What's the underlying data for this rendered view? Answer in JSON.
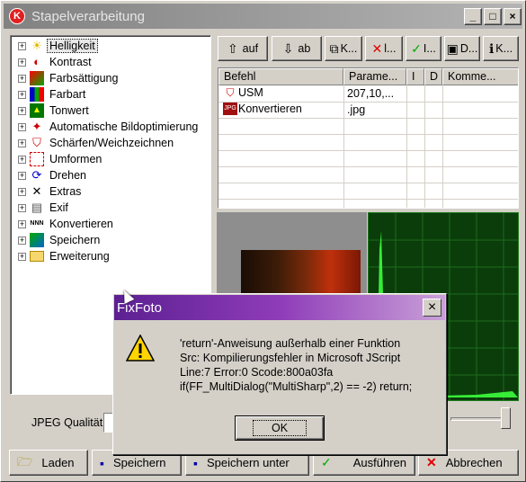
{
  "window": {
    "title": "Stapelverarbeitung",
    "controls": [
      "_",
      "□",
      "×"
    ]
  },
  "tree": {
    "items": [
      {
        "label": "Helligkeit",
        "icon": "sun-icon"
      },
      {
        "label": "Kontrast",
        "icon": "contrast-icon"
      },
      {
        "label": "Farbsättigung",
        "icon": "saturation-icon"
      },
      {
        "label": "Farbart",
        "icon": "color-bars-icon"
      },
      {
        "label": "Tonwert",
        "icon": "tonal-icon"
      },
      {
        "label": "Automatische Bildoptimierung",
        "icon": "auto-optimize-icon"
      },
      {
        "label": "Schärfen/Weichzeichnen",
        "icon": "sharpen-icon"
      },
      {
        "label": "Umformen",
        "icon": "transform-icon"
      },
      {
        "label": "Drehen",
        "icon": "rotate-icon"
      },
      {
        "label": "Extras",
        "icon": "extras-icon"
      },
      {
        "label": "Exif",
        "icon": "exif-icon"
      },
      {
        "label": "Konvertieren",
        "icon": "convert-icon"
      },
      {
        "label": "Speichern",
        "icon": "save-icon"
      },
      {
        "label": "Erweiterung",
        "icon": "folder-icon"
      }
    ],
    "selected_index": 0
  },
  "toolbar": {
    "up_label": "auf",
    "down_label": "ab",
    "copy_label": "K...",
    "delete_label": "l...",
    "check_label": "I...",
    "d_label": "D...",
    "info_label": "K..."
  },
  "table": {
    "headers": [
      "Befehl",
      "Parame...",
      "I",
      "D",
      "Komme..."
    ],
    "rows": [
      {
        "command": "USM",
        "params": "207,10,...",
        "icon": "usm-icon"
      },
      {
        "command": "Konvertieren",
        "params": ".jpg",
        "icon": "jpg-icon"
      }
    ]
  },
  "jpeg": {
    "label": "JPEG Qualität"
  },
  "bottom_buttons": {
    "load": "Laden",
    "save": "Speichern",
    "save_under": "Speichern unter",
    "run": "Ausführen",
    "cancel": "Abbrechen"
  },
  "dialog": {
    "title": "FixFoto",
    "message_lines": [
      "'return'-Anweisung außerhalb einer Funktion",
      "Src: Kompilierungsfehler in Microsoft JScript",
      "Line:7 Error:0 Scode:800a03fa",
      "if(FF_MultiDialog(\"MultiSharp\",2) == -2) return;"
    ],
    "ok_label": "OK"
  },
  "colors": {
    "dialog_title_start": "#5c2092",
    "histogram_bg": "#0b3d0b",
    "histogram_line": "#3cff3c"
  }
}
